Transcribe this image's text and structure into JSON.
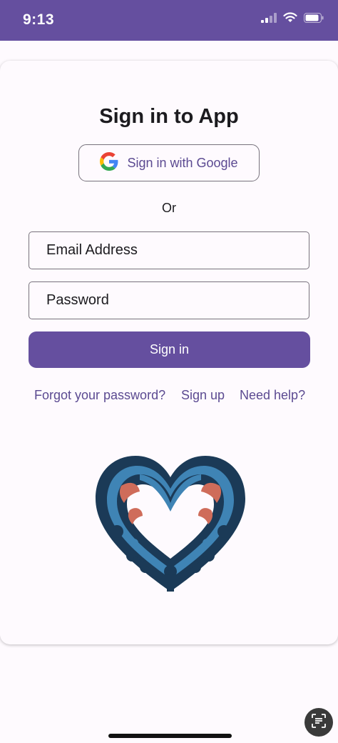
{
  "status_bar": {
    "time": "9:13",
    "background": "#654f9f"
  },
  "card": {
    "title": "Sign in to App",
    "google_button_label": "Sign in with Google",
    "or_text": "Or",
    "email_placeholder": "Email Address",
    "password_placeholder": "Password",
    "signin_button_label": "Sign in",
    "links": {
      "forgot_password": "Forgot your password?",
      "sign_up": "Sign up",
      "need_help": "Need help?"
    }
  },
  "colors": {
    "primary": "#654f9f",
    "link": "#5b4a91",
    "logo_dark": "#1b3a57",
    "logo_blue": "#3f84b5",
    "logo_red": "#cf6c5a"
  },
  "icons": {
    "status": [
      "signal-icon",
      "wifi-icon",
      "battery-icon"
    ],
    "google": "google-g-icon",
    "scan": "text-scan-icon"
  }
}
